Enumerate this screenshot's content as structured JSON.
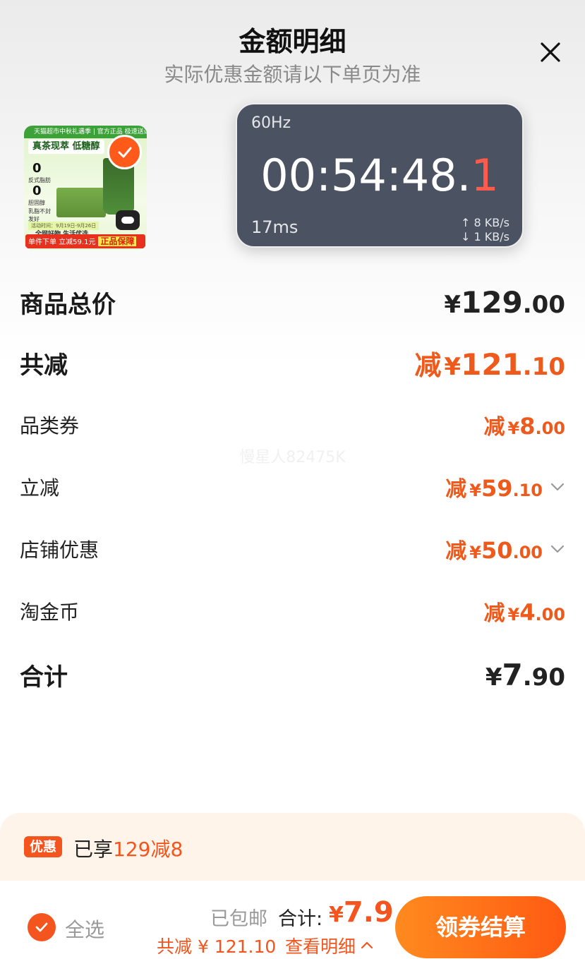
{
  "header": {
    "title": "金额明细",
    "subtitle": "实际优惠金额请以下单页为准"
  },
  "product": {
    "top_banner": "天猫超市中秋礼遇季 | 官方正品 极速送达",
    "headline": "真茶现萃 低糖醇",
    "stat1": "0",
    "stat1_label": "反式脂肪",
    "stat2": "0",
    "stat2_label": "胆固醇",
    "stat3_label": "乳脂不封 发好",
    "date_text": "活动时间：9月19日-9月26日",
    "mid_text": "全网好物 生活优选",
    "bottom_text": "单件下单 立减59.1元",
    "bottom_badge": "正品保障",
    "selected": true
  },
  "timer_overlay": {
    "refresh": "60Hz",
    "time_main": "00:54:48.",
    "time_last": "1",
    "latency": "17ms",
    "upload": "↑ 8 KB/s",
    "download": "↓ 1 KB/s"
  },
  "rows": {
    "total_price": {
      "label": "商品总价",
      "cur": "¥",
      "int": "129",
      "dec": ".00"
    },
    "total_discount": {
      "label": "共减",
      "pre": "减",
      "cur": "¥",
      "int": "121",
      "dec": ".10"
    },
    "category_coupon": {
      "label": "品类券",
      "pre": "减",
      "cur": "¥",
      "int": "8",
      "dec": ".00"
    },
    "instant_discount": {
      "label": "立减",
      "pre": "减",
      "cur": "¥",
      "int": "59",
      "dec": ".10"
    },
    "store_discount": {
      "label": "店铺优惠",
      "pre": "减",
      "cur": "¥",
      "int": "50",
      "dec": ".00"
    },
    "taojin_coins": {
      "label": "淘金币",
      "pre": "减",
      "cur": "¥",
      "int": "4",
      "dec": ".00"
    },
    "grand_total": {
      "label": "合计",
      "cur": "¥",
      "int": "7",
      "dec": ".90"
    }
  },
  "watermark": "慢星人82475K",
  "promo": {
    "tag": "优惠",
    "text_prefix": "已享",
    "text_highlight": "129减8"
  },
  "bottom_bar": {
    "select_all": "全选",
    "shipping": "已包邮",
    "total_label": "合计:",
    "total_cur": "¥",
    "total_value": "7.9",
    "saved_text": "共减 ¥ 121.10",
    "detail_link": "查看明细",
    "checkout": "领券结算"
  },
  "colors": {
    "accent": "#f4541d",
    "discount_text": "#ee5a1b",
    "promo_bg": "#fff4ea",
    "timer_bg": "#4b5262"
  }
}
